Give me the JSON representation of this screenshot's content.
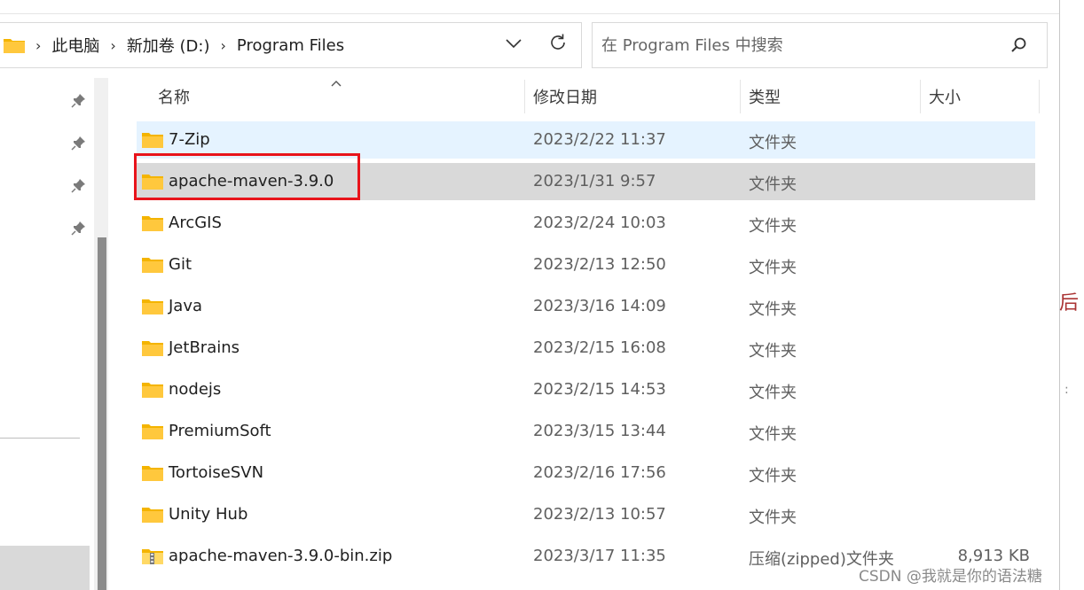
{
  "address": {
    "breadcrumbs": [
      "此电脑",
      "新加卷 (D:)",
      "Program Files"
    ]
  },
  "search": {
    "placeholder": "在 Program Files 中搜索"
  },
  "columns": {
    "name": "名称",
    "date": "修改日期",
    "type": "类型",
    "size": "大小"
  },
  "files": [
    {
      "name": "7-Zip",
      "date": "2023/2/22 11:37",
      "type": "文件夹",
      "size": "",
      "icon": "folder-icon"
    },
    {
      "name": "apache-maven-3.9.0",
      "date": "2023/1/31 9:57",
      "type": "文件夹",
      "size": "",
      "icon": "folder-icon"
    },
    {
      "name": "ArcGIS",
      "date": "2023/2/24 10:03",
      "type": "文件夹",
      "size": "",
      "icon": "folder-icon"
    },
    {
      "name": "Git",
      "date": "2023/2/13 12:50",
      "type": "文件夹",
      "size": "",
      "icon": "folder-icon"
    },
    {
      "name": "Java",
      "date": "2023/3/16 14:09",
      "type": "文件夹",
      "size": "",
      "icon": "folder-icon"
    },
    {
      "name": "JetBrains",
      "date": "2023/2/15 16:08",
      "type": "文件夹",
      "size": "",
      "icon": "folder-icon"
    },
    {
      "name": "nodejs",
      "date": "2023/2/15 14:53",
      "type": "文件夹",
      "size": "",
      "icon": "folder-icon"
    },
    {
      "name": "PremiumSoft",
      "date": "2023/3/15 13:44",
      "type": "文件夹",
      "size": "",
      "icon": "folder-icon"
    },
    {
      "name": "TortoiseSVN",
      "date": "2023/2/16 17:56",
      "type": "文件夹",
      "size": "",
      "icon": "folder-icon"
    },
    {
      "name": "Unity Hub",
      "date": "2023/2/13 10:57",
      "type": "文件夹",
      "size": "",
      "icon": "folder-icon"
    },
    {
      "name": "apache-maven-3.9.0-bin.zip",
      "date": "2023/3/17 11:35",
      "type": "压缩(zipped)文件夹",
      "size": "8,913 KB",
      "icon": "zip-folder-icon"
    }
  ],
  "edge_text": "后",
  "watermark": "CSDN @我就是你的语法糖️",
  "colors": {
    "hover_row": "#e5f3ff",
    "selected_row": "#d9d9d9",
    "highlight_box": "#e8141b",
    "folder_yellow": "#ffc83d"
  }
}
